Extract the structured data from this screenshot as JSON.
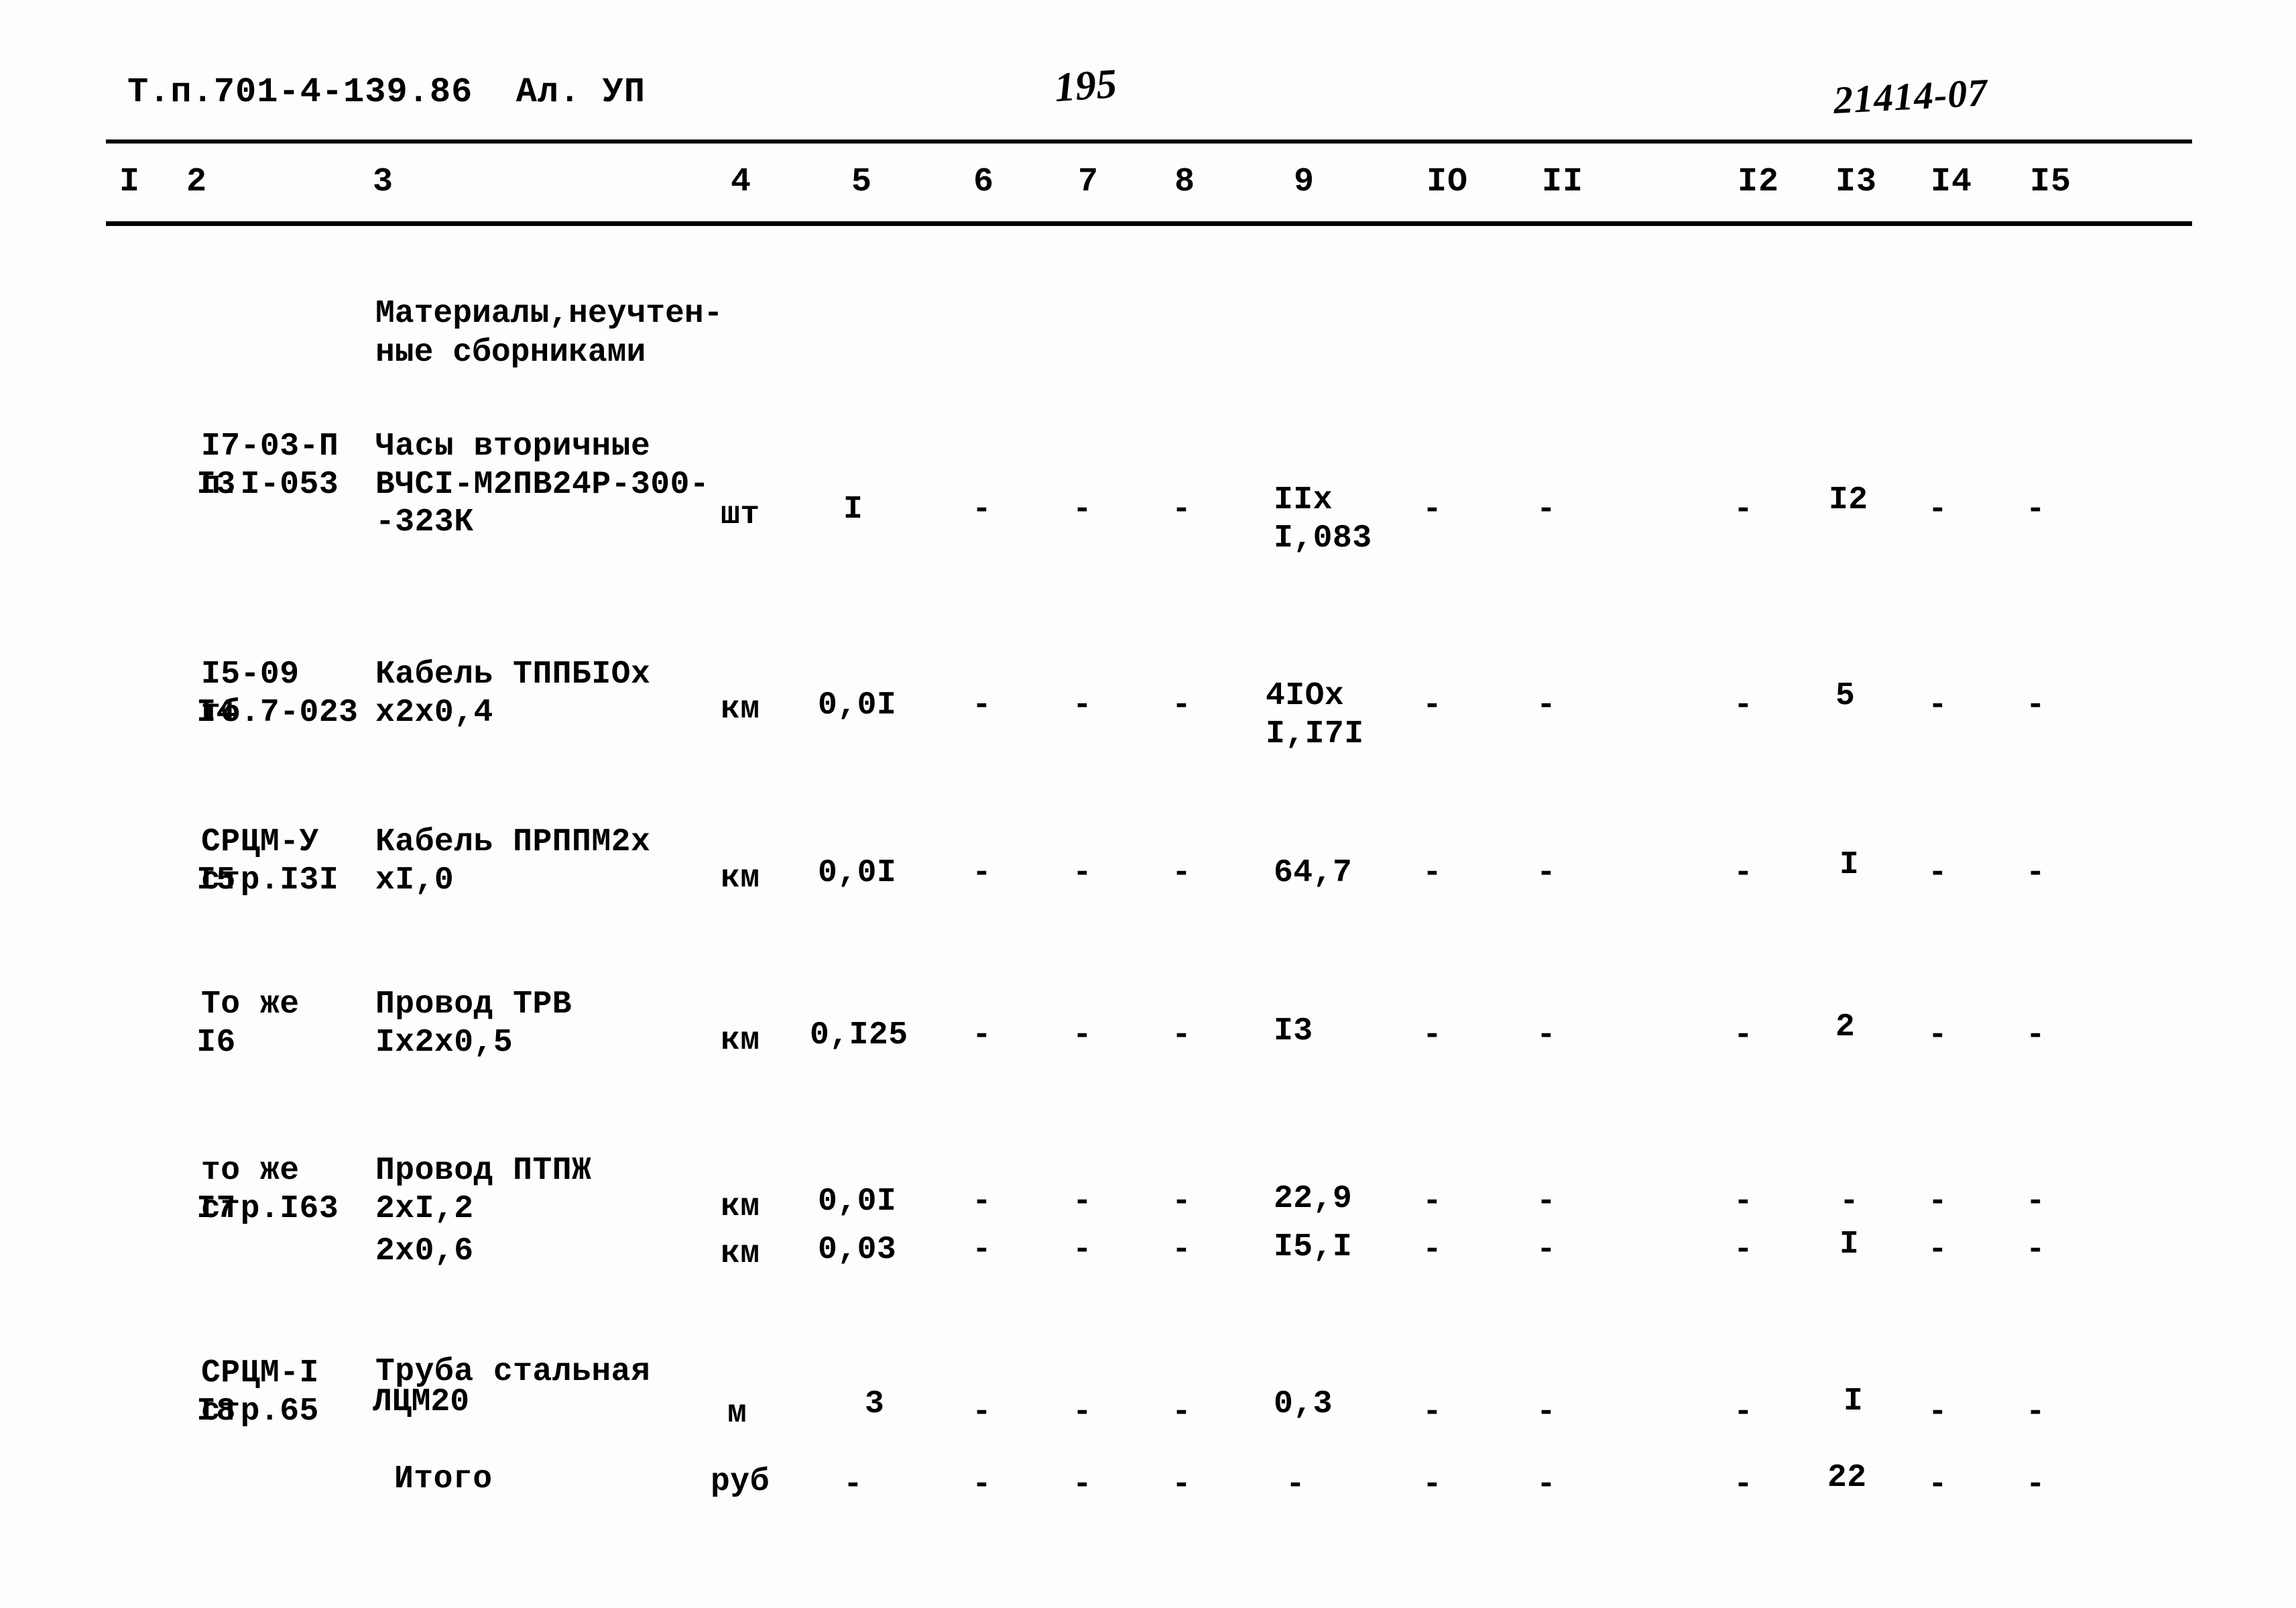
{
  "header": {
    "doc_code": "Т.п.701-4-139.86  Ал. УП",
    "page_number": "195",
    "sheet_number": "21414-07"
  },
  "table": {
    "column_headers": [
      "I",
      "2",
      "3",
      "4",
      "5",
      "6",
      "7",
      "8",
      "9",
      "IO",
      "II",
      "I2",
      "I3",
      "I4",
      "I5"
    ],
    "section_title_line1": "Материалы,неучтен-",
    "section_title_line2": "ные сборниками",
    "rows": [
      {
        "num": "I3",
        "code_line1": "I7-03-П",
        "code_line2": "п.I-053",
        "name_line1": "Часы вторичные",
        "name_line2": "ВЧСI-М2ПВ24Р-300-",
        "name_line3": "-323К",
        "unit": "шт",
        "c5": "I",
        "c6": "-",
        "c7": "-",
        "c8": "-",
        "c9_line1": "IIx",
        "c9_line2": "I,083",
        "c10": "-",
        "c11": "-",
        "c12": "-",
        "c13": "I2",
        "c14": "-",
        "c15": "-"
      },
      {
        "num": "I4",
        "code_line1": "I5-09",
        "code_line2": "тб.7-023",
        "name_line1": "Кабель ТППБIОх",
        "name_line2": "х2х0,4",
        "name_line3": "",
        "unit": "км",
        "c5": "0,0I",
        "c6": "-",
        "c7": "-",
        "c8": "-",
        "c9_line1": "4IOx",
        "c9_line2": "I,I7I",
        "c10": "-",
        "c11": "-",
        "c12": "-",
        "c13": "5",
        "c14": "-",
        "c15": "-"
      },
      {
        "num": "I5",
        "code_line1": "СРЦМ-У",
        "code_line2": "стр.I3I",
        "name_line1": "Кабель ПРППМ2х",
        "name_line2": "хI,0",
        "name_line3": "",
        "unit": "км",
        "c5": "0,0I",
        "c6": "-",
        "c7": "-",
        "c8": "-",
        "c9_line1": "64,7",
        "c9_line2": "",
        "c10": "-",
        "c11": "-",
        "c12": "-",
        "c13": "I",
        "c14": "-",
        "c15": "-"
      },
      {
        "num": "I6",
        "code_line1": "То же",
        "code_line2": "",
        "name_line1": "Провод ТРВ",
        "name_line2": "Iх2х0,5",
        "name_line3": "",
        "unit": "км",
        "c5": "0,I25",
        "c6": "-",
        "c7": "-",
        "c8": "-",
        "c9_line1": "I3",
        "c9_line2": "",
        "c10": "-",
        "c11": "-",
        "c12": "-",
        "c13": "2",
        "c14": "-",
        "c15": "-"
      },
      {
        "num": "I7",
        "code_line1": "то же",
        "code_line2": "стр.I63",
        "name_line1": "Провод ПТПЖ",
        "name_line2": "2хI,2",
        "name_line3": "",
        "unit": "км",
        "c5": "0,0I",
        "c6": "-",
        "c7": "-",
        "c8": "-",
        "c9_line1": "22,9",
        "c9_line2": "",
        "c10": "-",
        "c11": "-",
        "c12": "-",
        "c13": "-",
        "c14": "-",
        "c15": "-"
      },
      {
        "num": "",
        "code_line1": "",
        "code_line2": "",
        "name_line1": "2х0,6",
        "name_line2": "",
        "name_line3": "",
        "unit": "км",
        "c5": "0,03",
        "c6": "-",
        "c7": "-",
        "c8": "-",
        "c9_line1": "I5,I",
        "c9_line2": "",
        "c10": "-",
        "c11": "-",
        "c12": "-",
        "c13": "I",
        "c14": "-",
        "c15": "-"
      },
      {
        "num": "I8",
        "code_line1": "СРЦМ-I",
        "code_line2": "стр.65",
        "name_line1": "Труба стальная",
        "name_line2": "ЛЦМ20",
        "name_line3": "",
        "unit": "м",
        "c5": "3",
        "c6": "-",
        "c7": "-",
        "c8": "-",
        "c9_line1": "0,3",
        "c9_line2": "",
        "c10": "-",
        "c11": "-",
        "c12": "-",
        "c13": "I",
        "c14": "-",
        "c15": "-"
      },
      {
        "num": "",
        "code_line1": "",
        "code_line2": "",
        "name_line1": "Итого",
        "name_line2": "",
        "name_line3": "",
        "unit": "руб",
        "c5": "-",
        "c6": "-",
        "c7": "-",
        "c8": "-",
        "c9_line1": "-",
        "c9_line2": "",
        "c10": "-",
        "c11": "-",
        "c12": "-",
        "c13": "22",
        "c14": "-",
        "c15": "-"
      }
    ]
  }
}
